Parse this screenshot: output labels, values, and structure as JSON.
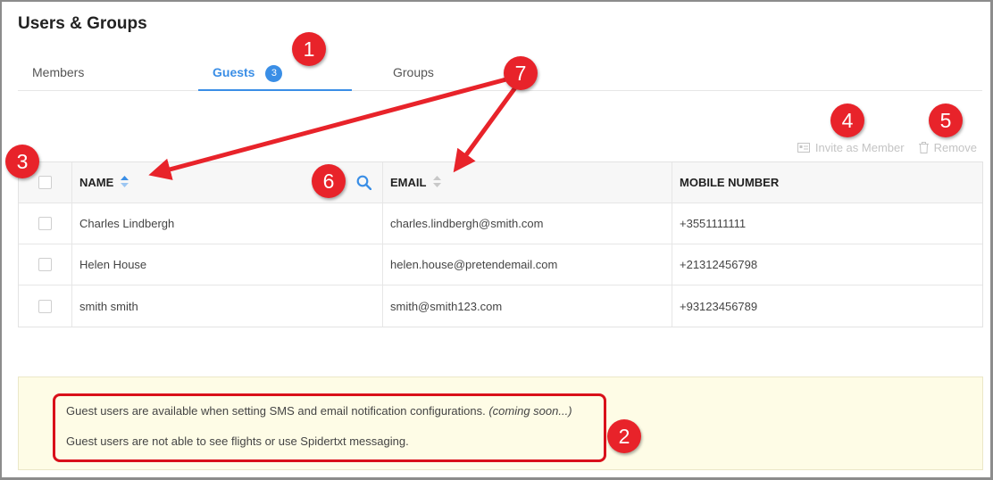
{
  "page_title": "Users & Groups",
  "tabs": [
    {
      "label": "Members"
    },
    {
      "label": "Guests",
      "count": "3"
    },
    {
      "label": "Groups"
    }
  ],
  "actions": {
    "invite_label": "Invite as Member",
    "remove_label": "Remove"
  },
  "table": {
    "columns": {
      "name": "NAME",
      "email": "EMAIL",
      "mobile": "MOBILE NUMBER"
    },
    "rows": [
      {
        "name": "Charles Lindbergh",
        "email": "charles.lindbergh@smith.com",
        "mobile": "+3551111111"
      },
      {
        "name": "Helen House",
        "email": "helen.house@pretendemail.com",
        "mobile": "+21312456798"
      },
      {
        "name": "smith smith",
        "email": "smith@smith123.com",
        "mobile": "+93123456789"
      }
    ]
  },
  "notice": {
    "line1": "Guest users are available when setting SMS and email notification configurations.",
    "line1_note": "(coming soon...)",
    "line2": "Guest users are not able to see flights or use Spidertxt messaging."
  },
  "markers": [
    "1",
    "2",
    "3",
    "4",
    "5",
    "6",
    "7"
  ],
  "colors": {
    "accent": "#3a8ee6",
    "annotation_red": "#d9101a",
    "notice_bg": "#fefce6"
  }
}
